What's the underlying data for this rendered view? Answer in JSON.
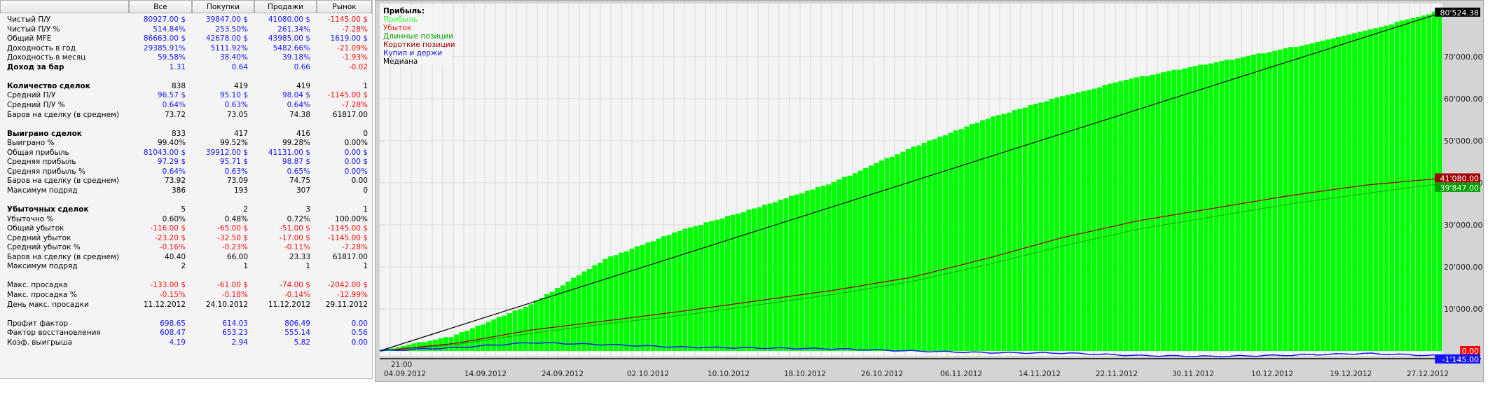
{
  "table": {
    "headers": [
      "",
      "Все",
      "Покупки",
      "Продажи",
      "Рынок"
    ],
    "rows": [
      {
        "label": "Чистый П/У",
        "bold": false,
        "values": [
          "80927.00 $",
          "39847.00 $",
          "41080.00 $",
          "-1145.00 $"
        ],
        "colors": [
          "b",
          "b",
          "b",
          "r"
        ]
      },
      {
        "label": "Чистый П/У %",
        "bold": false,
        "values": [
          "514.84%",
          "253.50%",
          "261.34%",
          "-7.28%"
        ],
        "colors": [
          "b",
          "b",
          "b",
          "r"
        ]
      },
      {
        "label": "Общий MFE",
        "bold": false,
        "values": [
          "86663.00 $",
          "42678.00 $",
          "43985.00 $",
          "1619.00 $"
        ],
        "colors": [
          "b",
          "b",
          "b",
          "b"
        ]
      },
      {
        "label": "Доходность в год",
        "bold": false,
        "values": [
          "29385.91%",
          "5111.92%",
          "5482.66%",
          "-21.09%"
        ],
        "colors": [
          "b",
          "b",
          "b",
          "r"
        ]
      },
      {
        "label": "Доходность в месяц",
        "bold": false,
        "values": [
          "59.58%",
          "38.40%",
          "39.18%",
          "-1.93%"
        ],
        "colors": [
          "b",
          "b",
          "b",
          "r"
        ]
      },
      {
        "label": "Доход за бар",
        "bold": true,
        "values": [
          "1.31",
          "0.64",
          "0.66",
          "-0.02"
        ],
        "colors": [
          "b",
          "b",
          "b",
          "r"
        ]
      },
      null,
      {
        "label": "Количество сделок",
        "bold": true,
        "values": [
          "838",
          "419",
          "419",
          "1"
        ],
        "colors": [
          "k",
          "k",
          "k",
          "k"
        ]
      },
      {
        "label": "Средний П/У",
        "bold": false,
        "values": [
          "96.57 $",
          "95.10 $",
          "98.04 $",
          "-1145.00 $"
        ],
        "colors": [
          "b",
          "b",
          "b",
          "r"
        ]
      },
      {
        "label": "Средний П/У %",
        "bold": false,
        "values": [
          "0.64%",
          "0.63%",
          "0.64%",
          "-7.28%"
        ],
        "colors": [
          "b",
          "b",
          "b",
          "r"
        ]
      },
      {
        "label": "Баров на сделку (в среднем)",
        "bold": false,
        "values": [
          "73.72",
          "73.05",
          "74.38",
          "61817.00"
        ],
        "colors": [
          "k",
          "k",
          "k",
          "k"
        ]
      },
      null,
      {
        "label": "Выиграно сделок",
        "bold": true,
        "values": [
          "833",
          "417",
          "416",
          "0"
        ],
        "colors": [
          "k",
          "k",
          "k",
          "k"
        ]
      },
      {
        "label": "Выиграно %",
        "bold": false,
        "values": [
          "99.40%",
          "99.52%",
          "99.28%",
          "0.00%"
        ],
        "colors": [
          "k",
          "k",
          "k",
          "k"
        ]
      },
      {
        "label": "Общая прибыль",
        "bold": false,
        "values": [
          "81043.00 $",
          "39912.00 $",
          "41131.00 $",
          "0.00 $"
        ],
        "colors": [
          "b",
          "b",
          "b",
          "b"
        ]
      },
      {
        "label": "Средняя прибыль",
        "bold": false,
        "values": [
          "97.29 $",
          "95.71 $",
          "98.87 $",
          "0.00 $"
        ],
        "colors": [
          "b",
          "b",
          "b",
          "b"
        ]
      },
      {
        "label": "Средняя прибыль %",
        "bold": false,
        "values": [
          "0.64%",
          "0.63%",
          "0.65%",
          "0.00%"
        ],
        "colors": [
          "b",
          "b",
          "b",
          "b"
        ]
      },
      {
        "label": "Баров на сделку (в среднем)",
        "bold": false,
        "values": [
          "73.92",
          "73.09",
          "74.75",
          "0.00"
        ],
        "colors": [
          "k",
          "k",
          "k",
          "k"
        ]
      },
      {
        "label": "Максимум подряд",
        "bold": false,
        "values": [
          "386",
          "193",
          "307",
          "0"
        ],
        "colors": [
          "k",
          "k",
          "k",
          "k"
        ]
      },
      null,
      {
        "label": "Убыточных сделок",
        "bold": true,
        "values": [
          "5",
          "2",
          "3",
          "1"
        ],
        "colors": [
          "k",
          "k",
          "k",
          "k"
        ]
      },
      {
        "label": "Убыточно %",
        "bold": false,
        "values": [
          "0.60%",
          "0.48%",
          "0.72%",
          "100.00%"
        ],
        "colors": [
          "k",
          "k",
          "k",
          "k"
        ]
      },
      {
        "label": "Общий убыток",
        "bold": false,
        "values": [
          "-116.00 $",
          "-65.00 $",
          "-51.00 $",
          "-1145.00 $"
        ],
        "colors": [
          "r",
          "r",
          "r",
          "r"
        ]
      },
      {
        "label": "Средний убыток",
        "bold": false,
        "values": [
          "-23.20 $",
          "-32.50 $",
          "-17.00 $",
          "-1145.00 $"
        ],
        "colors": [
          "r",
          "r",
          "r",
          "r"
        ]
      },
      {
        "label": "Средний убыток %",
        "bold": false,
        "values": [
          "-0.16%",
          "-0.23%",
          "-0.11%",
          "-7.28%"
        ],
        "colors": [
          "r",
          "r",
          "r",
          "r"
        ]
      },
      {
        "label": "Баров на сделку (в среднем)",
        "bold": false,
        "values": [
          "40.40",
          "66.00",
          "23.33",
          "61817.00"
        ],
        "colors": [
          "k",
          "k",
          "k",
          "k"
        ]
      },
      {
        "label": "Максимум подряд",
        "bold": false,
        "values": [
          "2",
          "1",
          "1",
          "1"
        ],
        "colors": [
          "k",
          "k",
          "k",
          "k"
        ]
      },
      null,
      {
        "label": "Макс. просадка",
        "bold": false,
        "values": [
          "-133.00 $",
          "-61.00 $",
          "-74.00 $",
          "-2042.00 $"
        ],
        "colors": [
          "r",
          "r",
          "r",
          "r"
        ]
      },
      {
        "label": "Макс. просадка %",
        "bold": false,
        "values": [
          "-0.15%",
          "-0.18%",
          "-0.14%",
          "-12.99%"
        ],
        "colors": [
          "r",
          "r",
          "r",
          "r"
        ]
      },
      {
        "label": "День макс. просадки",
        "bold": false,
        "values": [
          "11.12.2012",
          "24.10.2012",
          "11.12.2012",
          "29.11.2012"
        ],
        "colors": [
          "k",
          "k",
          "k",
          "k"
        ]
      },
      null,
      {
        "label": "Профит фактор",
        "bold": false,
        "values": [
          "698.65",
          "614.03",
          "806.49",
          "0.00"
        ],
        "colors": [
          "b",
          "b",
          "b",
          "b"
        ]
      },
      {
        "label": "Фактор восстановления",
        "bold": false,
        "values": [
          "608.47",
          "653.23",
          "555.14",
          "0.56"
        ],
        "colors": [
          "b",
          "b",
          "b",
          "b"
        ]
      },
      {
        "label": "Коэф. выигрыша",
        "bold": false,
        "values": [
          "4.19",
          "2.94",
          "5.82",
          "0.00"
        ],
        "colors": [
          "b",
          "b",
          "b",
          "b"
        ]
      }
    ]
  },
  "colors": {
    "b": "#1414ff",
    "r": "#ff1010",
    "k": "#000000"
  },
  "chart_data": {
    "type": "bar",
    "title": "Прибыль:",
    "legend": [
      {
        "label": "Прибыль",
        "color": "#33ff33"
      },
      {
        "label": "Убыток",
        "color": "#ff2020"
      },
      {
        "label": "Длинные позиции",
        "color": "#00a000"
      },
      {
        "label": "Короткие позиции",
        "color": "#a00000"
      },
      {
        "label": "Купил и держи",
        "color": "#1414ff"
      },
      {
        "label": "Медиана",
        "color": "#000000"
      }
    ],
    "legend_position": "top-left",
    "first_time_label": "21:00",
    "x_ticks": [
      "04.09.2012",
      "14.09.2012",
      "24.09.2012",
      "02.10.2012",
      "10.10.2012",
      "18.10.2012",
      "26.10.2012",
      "06.11.2012",
      "14.11.2012",
      "22.11.2012",
      "30.11.2012",
      "10.12.2012",
      "19.12.2012",
      "27.12.2012"
    ],
    "y_ticks": [
      "10'000.00",
      "20'000.00",
      "30'000.00",
      "40'000.00",
      "50'000.00",
      "60'000.00",
      "70'000.00"
    ],
    "ylim": [
      -1500,
      83000
    ],
    "bar_count": 200,
    "series": [
      {
        "name": "Прибыль",
        "checkpoints": [
          0,
          3500,
          10800,
          21800,
          28700,
          34000,
          40000,
          48000,
          55000,
          60500,
          65000,
          68500,
          72000,
          76000,
          80927
        ]
      },
      {
        "name": "Длинные позиции",
        "checkpoints": [
          0,
          1500,
          4200,
          6500,
          8500,
          11000,
          13500,
          16500,
          20500,
          25000,
          29000,
          32000,
          35000,
          37500,
          39847
        ]
      },
      {
        "name": "Короткие позиции",
        "checkpoints": [
          0,
          1800,
          5000,
          7200,
          9500,
          12000,
          14500,
          17500,
          22000,
          27000,
          31000,
          34000,
          37000,
          39500,
          41080
        ]
      },
      {
        "name": "Купил и держи",
        "checkpoints": [
          0,
          800,
          2000,
          1500,
          900,
          700,
          500,
          0,
          -400,
          -500,
          -1100,
          -1300,
          -1000,
          -600,
          -1145
        ]
      },
      {
        "name": "Медиана",
        "checkpoints": [
          0,
          80524.38
        ]
      }
    ],
    "value_tags": [
      {
        "text": "80'524.38",
        "value": 80524.38,
        "bg": "#000000",
        "fg": "#ffffff"
      },
      {
        "text": "41'080.00",
        "value": 41080,
        "bg": "#a00000",
        "fg": "#ffffff"
      },
      {
        "text": "39'847.00",
        "value": 39847,
        "bg": "#00a000",
        "fg": "#ffffff"
      },
      {
        "text": "0.00",
        "value": 0,
        "bg": "#ff0000",
        "fg": "#ffffff"
      },
      {
        "text": "-1'145.00",
        "value": -1145,
        "bg": "#1414ff",
        "fg": "#ffffff"
      }
    ]
  }
}
